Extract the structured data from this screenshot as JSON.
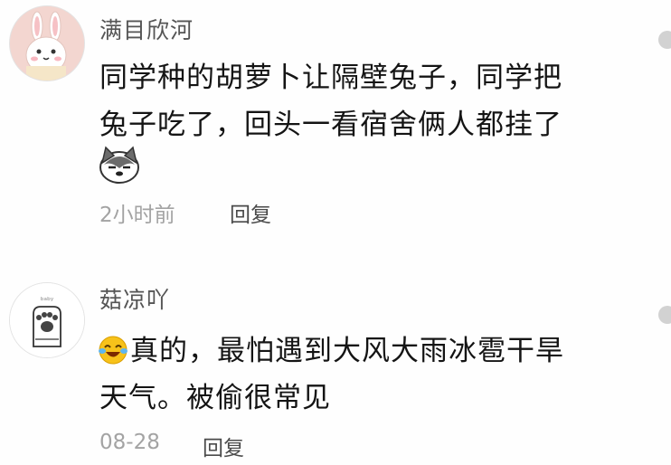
{
  "comments": [
    {
      "username": "满目欣河",
      "lines": [
        "同学种的胡萝卜让隔壁兔子，同学把",
        "兔子吃了，回头一看宿舍俩人都挂了"
      ],
      "time": "2小时前",
      "reply_label": "回复",
      "avatar_icon": "bunny-avatar",
      "sticker_icon": "husky-dog-emoji"
    },
    {
      "username": "菇凉吖",
      "lines": [
        "真的，最怕遇到大风大雨冰雹干旱",
        "天气。被偷很常见"
      ],
      "time": "08-28",
      "reply_label": "回复",
      "avatar_icon": "cat-paw-avatar",
      "inline_emoji": "laughing-crying-emoji",
      "avatar_text": "ᵇᵃᵇʸ"
    }
  ],
  "colors": {
    "username": "#555555",
    "text": "#141414",
    "meta": "#a3a3a3",
    "reply": "#4a4a4a"
  }
}
